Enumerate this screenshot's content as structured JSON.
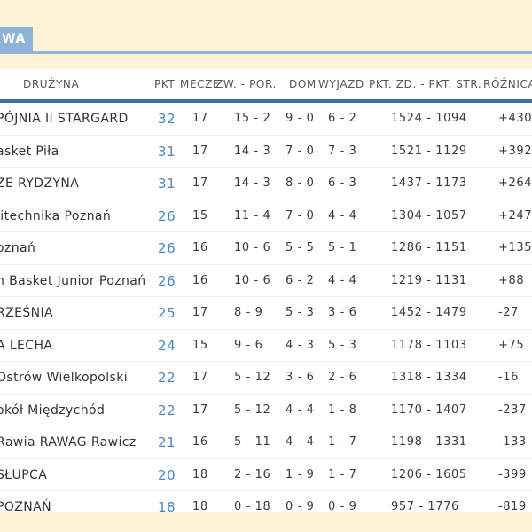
{
  "tab": {
    "label": "WA"
  },
  "columns": {
    "team": "DRUŻYNA",
    "pkt": "PKT",
    "mecze": "MECZE",
    "zw_por": "ZW. - POR.",
    "dom": "DOM",
    "wyjazd": "WYJAZD",
    "pkt_zd_str": "PKT. ZD. - PKT. STR.",
    "roznica": "RÓŻNICA"
  },
  "rows": [
    {
      "team": "PÓJNIA II STARGARD",
      "pkt": "32",
      "mecze": "17",
      "zw_por": "15 - 2",
      "dom": "9 - 0",
      "wyjazd": "6 - 2",
      "pts": "1524 - 1094",
      "diff": "+430"
    },
    {
      "team": "asket Piła",
      "pkt": "31",
      "mecze": "17",
      "zw_por": "14 - 3",
      "dom": "7 - 0",
      "wyjazd": "7 - 3",
      "pts": "1521 - 1129",
      "diff": "+392"
    },
    {
      "team": "ZE RYDZYNA",
      "pkt": "31",
      "mecze": "17",
      "zw_por": "14 - 3",
      "dom": "8 - 0",
      "wyjazd": "6 - 3",
      "pts": "1437 - 1173",
      "diff": "+264"
    },
    {
      "team": "litechnika Poznań",
      "pkt": "26",
      "mecze": "15",
      "zw_por": "11 - 4",
      "dom": "7 - 0",
      "wyjazd": "4 - 4",
      "pts": "1304 - 1057",
      "diff": "+247"
    },
    {
      "team": "oznań",
      "pkt": "26",
      "mecze": "16",
      "zw_por": "10 - 6",
      "dom": "5 - 5",
      "wyjazd": "5 - 1",
      "pts": "1286 - 1151",
      "diff": "+135"
    },
    {
      "team": "n Basket Junior Poznań",
      "pkt": "26",
      "mecze": "16",
      "zw_por": "10 - 6",
      "dom": "6 - 2",
      "wyjazd": "4 - 4",
      "pts": "1219 - 1131",
      "diff": "+88"
    },
    {
      "team": "RZEŚNIA",
      "pkt": "25",
      "mecze": "17",
      "zw_por": "8 - 9",
      "dom": "5 - 3",
      "wyjazd": "3 - 6",
      "pts": "1452 - 1479",
      "diff": "-27"
    },
    {
      "team": "A LECHA",
      "pkt": "24",
      "mecze": "15",
      "zw_por": "9 - 6",
      "dom": "4 - 3",
      "wyjazd": "5 - 3",
      "pts": "1178 - 1103",
      "diff": "+75"
    },
    {
      "team": "Ostrów Wielkopolski",
      "pkt": "22",
      "mecze": "17",
      "zw_por": "5 - 12",
      "dom": "3 - 6",
      "wyjazd": "2 - 6",
      "pts": "1318 - 1334",
      "diff": "-16"
    },
    {
      "team": "okół Międzychód",
      "pkt": "22",
      "mecze": "17",
      "zw_por": "5 - 12",
      "dom": "4 - 4",
      "wyjazd": "1 - 8",
      "pts": "1170 - 1407",
      "diff": "-237"
    },
    {
      "team": "Rawia RAWAG Rawicz",
      "pkt": "21",
      "mecze": "16",
      "zw_por": "5 - 11",
      "dom": "4 - 4",
      "wyjazd": "1 - 7",
      "pts": "1198 - 1331",
      "diff": "-133"
    },
    {
      "team": "SŁUPCA",
      "pkt": "20",
      "mecze": "18",
      "zw_por": "2 - 16",
      "dom": "1 - 9",
      "wyjazd": "1 - 7",
      "pts": "1206 - 1605",
      "diff": "-399"
    },
    {
      "team": "POZNAŃ",
      "pkt": "18",
      "mecze": "18",
      "zw_por": "0 - 18",
      "dom": "0 - 9",
      "wyjazd": "0 - 9",
      "pts": "957 - 1776",
      "diff": "-819"
    }
  ],
  "colors": {
    "accent": "#8db4d6",
    "header_rule": "#3f6ea0",
    "points": "#4a86c5",
    "background": "#fdf4d6"
  }
}
